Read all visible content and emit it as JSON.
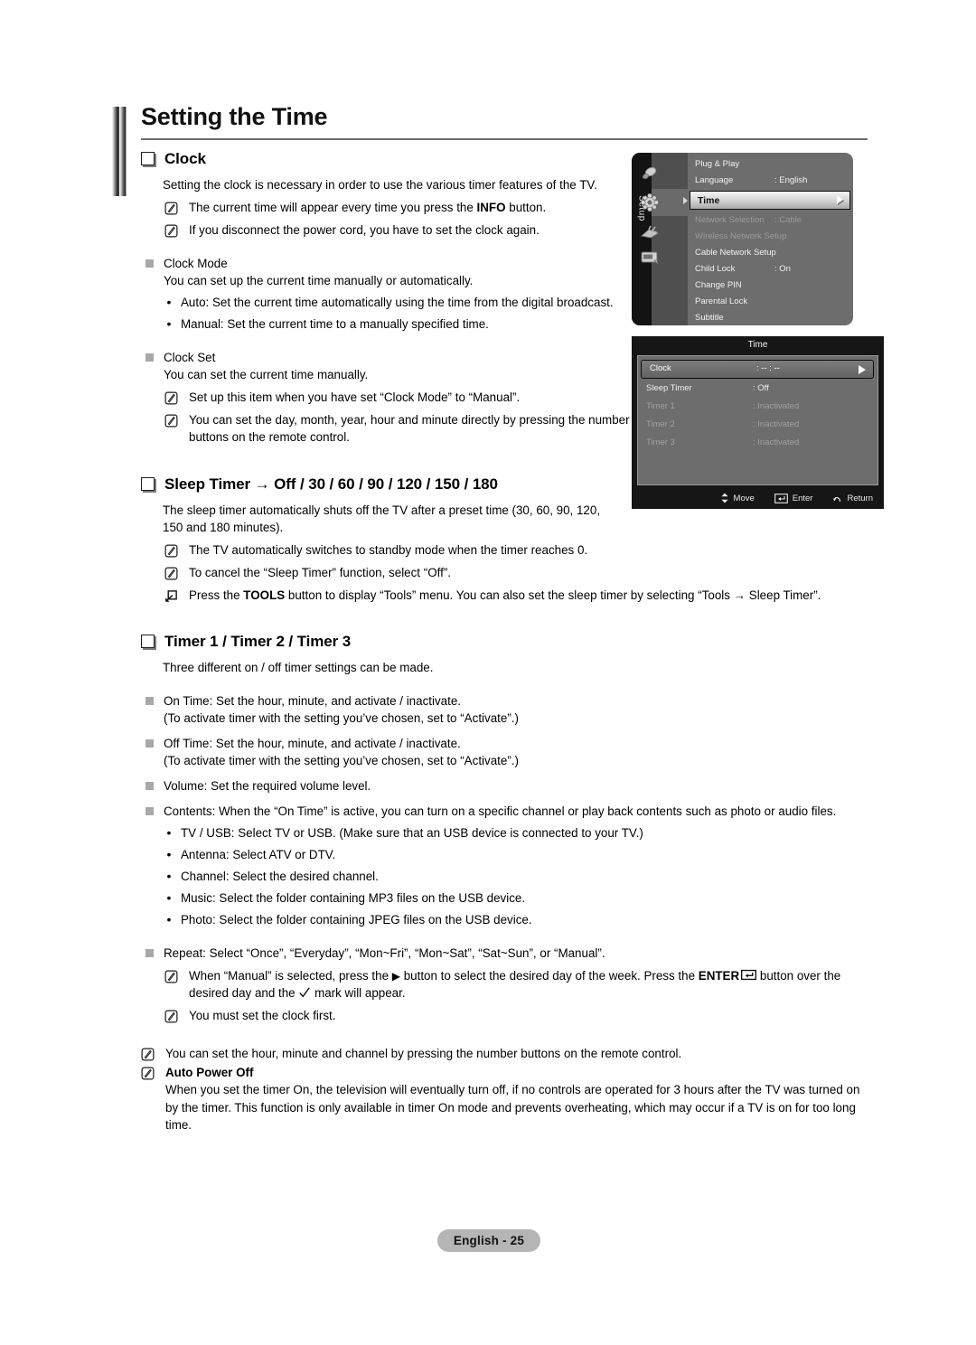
{
  "page": {
    "title": "Setting the Time",
    "footer_badge": "English - 25"
  },
  "sections": {
    "clock": {
      "heading": "Clock",
      "intro": "Setting the clock is necessary in order to use the various timer features of the TV.",
      "notes": [
        "The current time will appear every time you press the INFO button.",
        "If you disconnect the power cord, you have to set the clock again."
      ],
      "note1_pre": "The current time will appear every time you press the ",
      "note1_bold": "INFO",
      "note1_post": " button.",
      "clock_mode": {
        "label": "Clock Mode",
        "desc": "You can set up the current time manually or automatically.",
        "bullets": [
          "Auto: Set the current time automatically using the time from the digital broadcast.",
          "Manual: Set the current time to a manually specified time."
        ]
      },
      "clock_set": {
        "label": "Clock Set",
        "desc": "You can set the current time manually.",
        "notes": [
          "Set up this item when you have set “Clock Mode” to “Manual”.",
          "You can set the day, month, year, hour and minute directly by pressing the number buttons on the remote control."
        ]
      }
    },
    "sleep_timer": {
      "heading": "Sleep Timer → Off / 30 / 60 / 90 / 120 / 150 / 180",
      "intro": "The sleep timer automatically shuts off the TV after a preset time (30, 60, 90, 120, 150 and 180 minutes).",
      "notes": [
        "The TV automatically switches to standby mode when the timer reaches 0.",
        "To cancel the “Sleep Timer” function, select “Off”."
      ],
      "tools_note_pre": "Press the ",
      "tools_note_bold": "TOOLS",
      "tools_note_post": " button to display “Tools” menu. You can also set the sleep timer by selecting “Tools → Sleep Timer”."
    },
    "timers": {
      "heading": "Timer 1 / Timer 2 / Timer 3",
      "intro": "Three different on / off timer settings can be made.",
      "items": [
        {
          "line1": "On Time: Set the hour, minute, and activate / inactivate.",
          "line2": "(To activate timer with the setting you’ve chosen, set to “Activate”.)"
        },
        {
          "line1": "Off Time: Set the hour, minute, and activate / inactivate.",
          "line2": "(To activate timer with the setting you’ve chosen, set to “Activate”.)"
        },
        {
          "line1": "Volume: Set the required volume level.",
          "line2": ""
        },
        {
          "line1": "Contents: When the “On Time” is active, you can turn on a specific channel or play back contents such as photo or audio files.",
          "line2": ""
        }
      ],
      "contents_bullets": [
        "TV / USB: Select TV or USB. (Make sure that an USB device is connected to your TV.)",
        "Antenna: Select ATV or DTV.",
        "Channel: Select the desired channel.",
        "Music: Select the folder containing MP3 files on the USB device.",
        "Photo: Select the folder containing JPEG files on the USB device."
      ],
      "repeat": {
        "line": "Repeat: Select “Once”, “Everyday”, “Mon~Fri”, “Mon~Sat”, “Sat~Sun”, or “Manual”.",
        "note_a1": "When “Manual” is selected, press the ",
        "note_a2": " button to select the desired day of the week. Press the ",
        "note_a_bold": "ENTER",
        "note_a3": " button over the desired day and the ",
        "note_a4": " mark will appear.",
        "note_b": "You must set the clock first."
      },
      "final_notes": {
        "note1": "You can set the hour, minute and channel by pressing the number buttons on the remote control.",
        "auto_power_off_title": "Auto Power Off",
        "auto_power_off_body": "When you set the timer On, the television will eventually turn off, if no controls are operated for 3 hours after the TV was turned on by the timer. This function is only available in timer On mode and prevents overheating, which may occur if a TV is on for too long time."
      }
    }
  },
  "osd_setup": {
    "rail_label": "Setup",
    "rows": [
      {
        "label": "Plug & Play",
        "value": "",
        "state": "normal"
      },
      {
        "label": "Language",
        "value": ": English",
        "state": "normal"
      },
      {
        "label": "Time",
        "value": "",
        "state": "selected"
      },
      {
        "label": "Network Selection",
        "value": ": Cable",
        "state": "dim"
      },
      {
        "label": "Wireless Network Setup",
        "value": "",
        "state": "dim"
      },
      {
        "label": "Cable Network Setup",
        "value": "",
        "state": "normal"
      },
      {
        "label": "Child Lock",
        "value": ": On",
        "state": "normal"
      },
      {
        "label": "Change PIN",
        "value": "",
        "state": "normal"
      },
      {
        "label": "Parental Lock",
        "value": "",
        "state": "normal"
      },
      {
        "label": "Subtitle",
        "value": "",
        "state": "normal"
      }
    ]
  },
  "osd_time": {
    "title": "Time",
    "rows": [
      {
        "label": "Clock",
        "value": ": -- : --",
        "state": "selected"
      },
      {
        "label": "Sleep Timer",
        "value": ": Off",
        "state": "normal"
      },
      {
        "label": "Timer 1",
        "value": ": Inactivated",
        "state": "dim"
      },
      {
        "label": "Timer 2",
        "value": ": Inactivated",
        "state": "dim"
      },
      {
        "label": "Timer 3",
        "value": ": Inactivated",
        "state": "dim"
      }
    ],
    "footer": [
      {
        "icon": "move-icon",
        "label": "Move"
      },
      {
        "icon": "enter-icon",
        "label": "Enter"
      },
      {
        "icon": "return-icon",
        "label": "Return"
      }
    ]
  },
  "colors": {
    "osd_panel_gray": "#6d6d6d",
    "osd_dark": "#161616",
    "badge_gray": "#b5b5b5",
    "rule_gray": "#6e6e6e"
  }
}
